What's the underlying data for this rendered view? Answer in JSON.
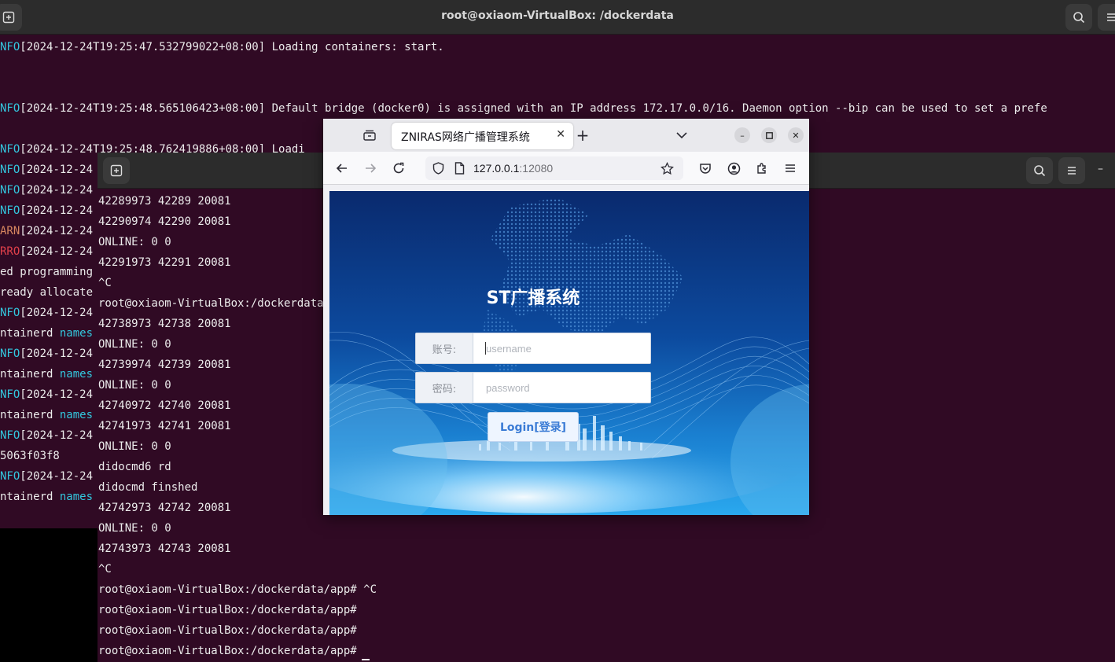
{
  "terminal_back": {
    "title": "root@oxiaom-VirtualBox: /dockerdata",
    "lines": [
      {
        "prefix": "NFO",
        "text": "[2024-12-24T19:25:47.532799022+08:00] Loading containers: start."
      },
      {
        "prefix": "NFO",
        "text": "[2024-12-24T19:25:48.565106423+08:00] Default bridge (docker0) is assigned with an IP address 172.17.0.0/16. Daemon option --bip can be used to set a prefe"
      },
      {
        "prefix": "NFO",
        "text": "[2024-12-24T19:25:48.762419886+08:00] Loadi"
      }
    ],
    "clipped_lines": [
      {
        "style": "info",
        "prefix": "NFO",
        "text": "[2024-12-24"
      },
      {
        "style": "info",
        "prefix": "NFO",
        "text": "[2024-12-24"
      },
      {
        "style": "info",
        "prefix": "NFO",
        "text": "[2024-12-24"
      },
      {
        "style": "warn",
        "prefix": "ARN",
        "text": "[2024-12-24"
      },
      {
        "style": "error",
        "prefix": "RRO",
        "text": "[2024-12-24"
      },
      {
        "style": "plain",
        "prefix": "",
        "text": "ed programming"
      },
      {
        "style": "plain",
        "prefix": "",
        "text": "ready allocate"
      },
      {
        "style": "info",
        "prefix": "NFO",
        "text": "[2024-12-24"
      },
      {
        "style": "names",
        "prefix": "ntainerd ",
        "text": "names"
      },
      {
        "style": "info",
        "prefix": "NFO",
        "text": "[2024-12-24"
      },
      {
        "style": "names",
        "prefix": "ntainerd ",
        "text": "names"
      },
      {
        "style": "info",
        "prefix": "NFO",
        "text": "[2024-12-24"
      },
      {
        "style": "names",
        "prefix": "ntainerd ",
        "text": "names"
      },
      {
        "style": "info",
        "prefix": "NFO",
        "text": "[2024-12-24"
      },
      {
        "style": "plain",
        "prefix": "",
        "text": "5063f03f8"
      },
      {
        "style": "info",
        "prefix": "NFO",
        "text": "[2024-12-24"
      },
      {
        "style": "names",
        "prefix": "ntainerd ",
        "text": "names"
      }
    ]
  },
  "terminal_front": {
    "lines": [
      "42289973 42289 20081",
      "42290974 42290 20081",
      "ONLINE: 0 0",
      "42291973 42291 20081",
      "^C",
      "root@oxiaom-VirtualBox:/dockerdata/app#",
      "42738973 42738 20081",
      "ONLINE: 0 0",
      "42739974 42739 20081",
      "ONLINE: 0 0",
      "42740972 42740 20081",
      "42741973 42741 20081",
      "ONLINE: 0 0",
      "didocmd6 rd",
      "didocmd finshed",
      "42742973 42742 20081",
      "ONLINE: 0 0",
      "42743973 42743 20081",
      "^C",
      "root@oxiaom-VirtualBox:/dockerdata/app# ^C",
      "root@oxiaom-VirtualBox:/dockerdata/app#",
      "root@oxiaom-VirtualBox:/dockerdata/app#",
      "root@oxiaom-VirtualBox:/dockerdata/app#"
    ]
  },
  "browser": {
    "tab_title": "ZNIRAS网络广播管理系统",
    "url_host": "127.0.0.1",
    "url_port": ":12080",
    "icons": {
      "tab_view": "browser-tabs-icon",
      "close_tab": "close-icon",
      "new_tab": "plus-icon",
      "list_tabs": "chevron-down-icon",
      "minimize": "minimize-icon",
      "maximize": "maximize-icon",
      "close_window": "close-icon",
      "back": "arrow-left-icon",
      "forward": "arrow-right-icon",
      "reload": "reload-icon",
      "shield": "shield-icon",
      "page": "page-icon",
      "bookmark": "star-icon",
      "pocket": "pocket-icon",
      "account": "account-icon",
      "extensions": "puzzle-icon",
      "menu": "hamburger-menu-icon"
    }
  },
  "login": {
    "title": "ST广播系统",
    "username_label": "账号:",
    "username_placeholder": "username",
    "password_label": "密码:",
    "password_placeholder": "password",
    "login_button": "Login[登录]"
  },
  "colors": {
    "terminal_bg": "#300a24",
    "header_bg": "#2c2c2c",
    "cyan": "#33c7de",
    "login_blue": "#0b3d8c"
  }
}
